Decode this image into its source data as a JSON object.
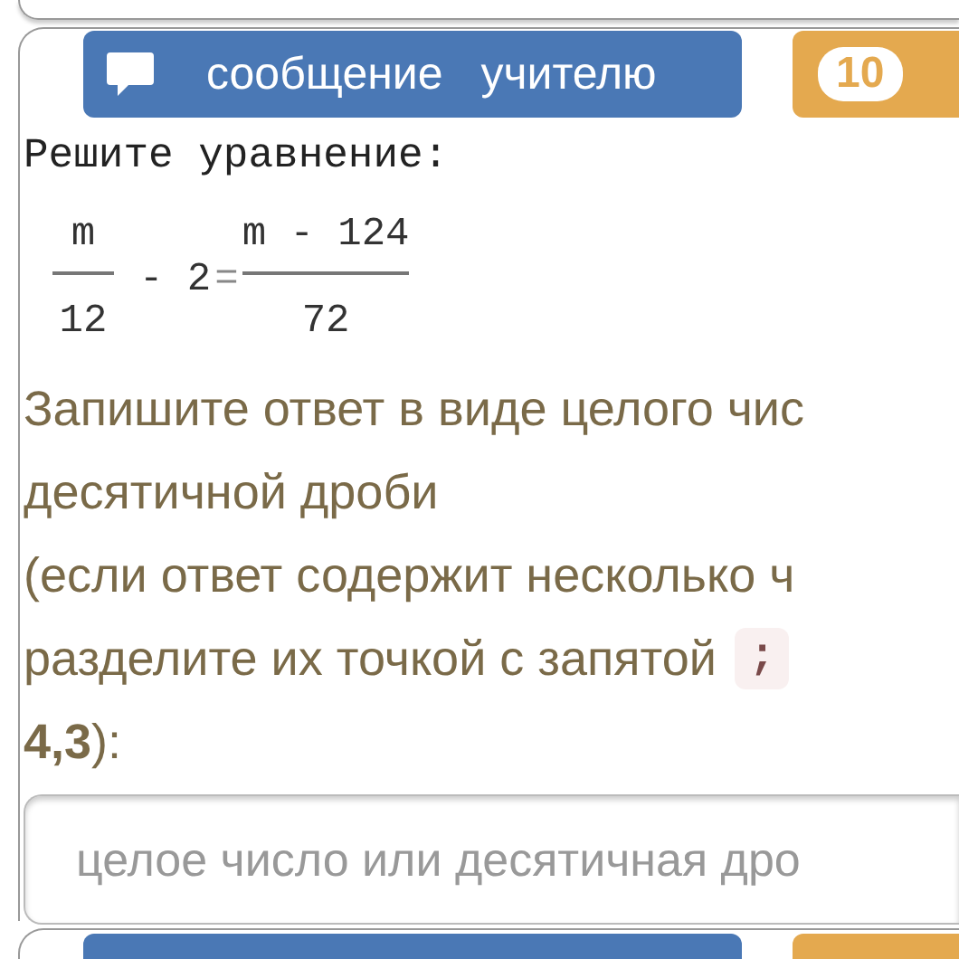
{
  "message_button": {
    "label": "сообщение учителю"
  },
  "points_badge": {
    "label": "10"
  },
  "task": {
    "title": "Решите уравнение:",
    "equation": {
      "left_numerator": "m",
      "left_denominator": "12",
      "minus": "- 2",
      "equals": "=",
      "right_numerator": "m - 124",
      "right_denominator": "72"
    },
    "instructions": [
      "Запишите ответ в виде целого чис",
      "десятичной дроби",
      "(если ответ содержит несколько ч"
    ],
    "separator_line": {
      "text": "разделите их точкой с запятой",
      "code": ";"
    },
    "example_line": "**4,3**):"
  },
  "answer_field": {
    "placeholder": "целое число или десятичная дро"
  }
}
